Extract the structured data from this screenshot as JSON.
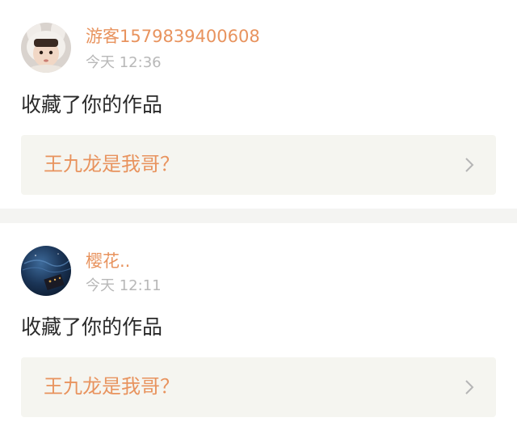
{
  "notifications": [
    {
      "username": "游客1579839400608",
      "time": "今天 12:36",
      "action": "收藏了你的作品",
      "work_title": "王九龙是我哥？",
      "avatar": "avatar-child-bunny-hat"
    },
    {
      "username": "樱花..",
      "time": "今天 12:11",
      "action": "收藏了你的作品",
      "work_title": "王九龙是我哥？",
      "avatar": "avatar-night-scene"
    }
  ],
  "colors": {
    "accent": "#e8935e",
    "muted": "#b8b8b8",
    "text": "#2a2a2a",
    "link_background": "#f5f5f0",
    "separator": "#f4f4f2"
  }
}
